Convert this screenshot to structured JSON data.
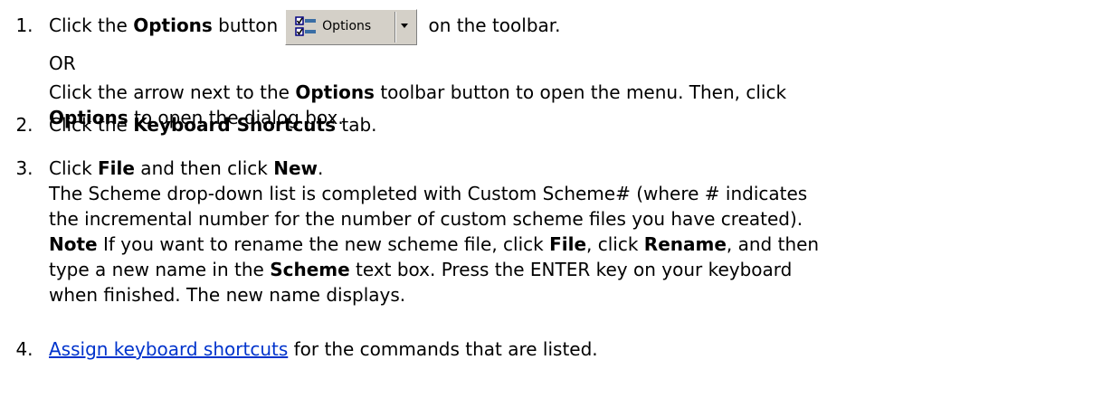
{
  "steps": [
    {
      "num": "1.",
      "l1_a": "Click the ",
      "l1_b": "Options",
      "l1_c": " button",
      "l1_d": " on the toolbar.",
      "toolbar_button_label": "Options",
      "or": "OR",
      "l3_a": "Click the arrow next to the ",
      "l3_b": "Options",
      "l3_c": " toolbar button to open the menu. Then, click",
      "l4_a": "Options",
      "l4_b": " to open the dialog box."
    },
    {
      "num": "2.",
      "a": "Click the ",
      "b": "Keyboard Shortcuts",
      "c": " tab."
    },
    {
      "num": "3.",
      "l1_a": "Click ",
      "l1_b": "File",
      "l1_c": " and then click ",
      "l1_d": "New",
      "l1_e": ".",
      "l2": "The Scheme drop-down list is completed with Custom Scheme# (where # indicates",
      "l3": "the incremental number for the number of custom scheme files you have created).",
      "l4_a": "Note",
      "l4_b": " If you want to rename the new scheme file, click ",
      "l4_c": "File",
      "l4_d": ", click ",
      "l4_e": "Rename",
      "l4_f": ", and then",
      "l5_a": "type a new name in the ",
      "l5_b": "Scheme",
      "l5_c": " text box. Press the ENTER key on your keyboard",
      "l6": "when finished. The new name displays."
    },
    {
      "num": "4.",
      "link": "Assign keyboard shortcuts",
      "rest": " for the commands that are listed."
    }
  ]
}
